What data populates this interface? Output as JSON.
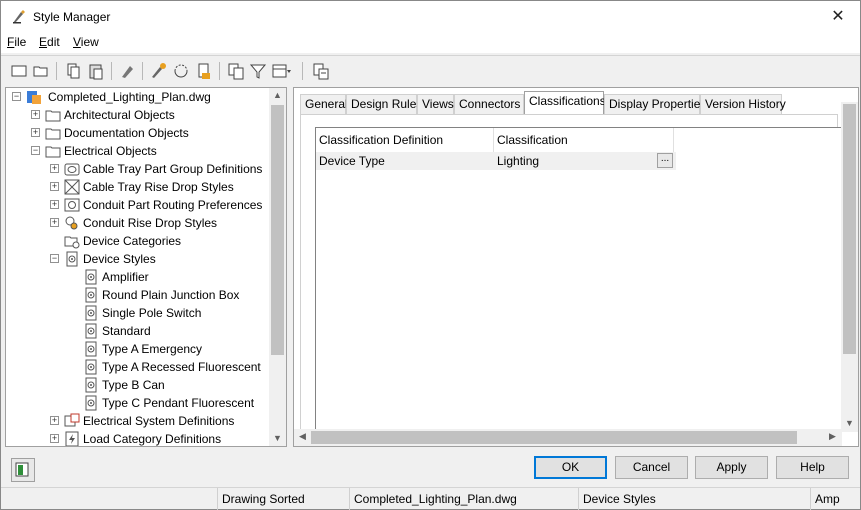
{
  "window": {
    "title": "Style Manager",
    "close_glyph": "✕"
  },
  "menu": {
    "items": [
      {
        "mnemonic": "F",
        "rest": "ile"
      },
      {
        "mnemonic": "E",
        "rest": "dit"
      },
      {
        "mnemonic": "V",
        "rest": "iew"
      }
    ]
  },
  "toolbar": {
    "icons": [
      "new-icon",
      "open-icon",
      "copy-icon",
      "paste-icon",
      "purge-icon",
      "edit-style-icon",
      "synchronize-icon",
      "version-icon",
      "toggle-view-icon",
      "filter-icon",
      "view-options-icon",
      "inquiry-icon"
    ]
  },
  "tree": {
    "root": "Completed_Lighting_Plan.dwg",
    "items": [
      {
        "label": "Architectural Objects",
        "icon": "folder-icon",
        "expander": "+"
      },
      {
        "label": "Documentation Objects",
        "icon": "folder-icon",
        "expander": "+"
      },
      {
        "label": "Electrical Objects",
        "icon": "folder-icon",
        "expander": "−"
      },
      {
        "label": "Cable Tray Part Group Definitions",
        "icon": "cable-tray-group-icon",
        "expander": "+"
      },
      {
        "label": "Cable Tray Rise Drop Styles",
        "icon": "rise-drop-icon",
        "expander": "+"
      },
      {
        "label": "Conduit Part Routing Preferences",
        "icon": "routing-pref-icon",
        "expander": "+"
      },
      {
        "label": "Conduit Rise Drop Styles",
        "icon": "conduit-rise-icon",
        "expander": "+"
      },
      {
        "label": "Device Categories",
        "icon": "device-category-icon",
        "expander": ""
      },
      {
        "label": "Device Styles",
        "icon": "device-style-icon",
        "expander": "−"
      },
      {
        "label": "Amplifier",
        "icon": "device-style-icon",
        "expander": ""
      },
      {
        "label": "Round Plain Junction Box",
        "icon": "device-style-icon",
        "expander": ""
      },
      {
        "label": "Single Pole Switch",
        "icon": "device-style-icon",
        "expander": ""
      },
      {
        "label": "Standard",
        "icon": "device-style-icon",
        "expander": ""
      },
      {
        "label": "Type A Emergency",
        "icon": "device-style-icon",
        "expander": ""
      },
      {
        "label": "Type A Recessed Fluorescent",
        "icon": "device-style-icon",
        "expander": ""
      },
      {
        "label": "Type B Can",
        "icon": "device-style-icon",
        "expander": ""
      },
      {
        "label": "Type C Pendant Fluorescent",
        "icon": "device-style-icon",
        "expander": ""
      },
      {
        "label": "Electrical System Definitions",
        "icon": "system-definition-icon",
        "expander": "+"
      },
      {
        "label": "Load Category Definitions",
        "icon": "load-category-icon",
        "expander": "+"
      }
    ]
  },
  "tabs": [
    "General",
    "Design Rules",
    "Views",
    "Connectors",
    "Classifications",
    "Display Properties",
    "Version History"
  ],
  "active_tab": "Classifications",
  "classifications": {
    "headers": [
      "Classification Definition",
      "Classification"
    ],
    "rows": [
      {
        "definition": "Device Type",
        "classification": "Lighting",
        "button": "..."
      }
    ]
  },
  "buttons": {
    "ok": "OK",
    "cancel": "Cancel",
    "apply": "Apply",
    "help": "Help"
  },
  "status": {
    "sort": "Drawing Sorted",
    "file": "Completed_Lighting_Plan.dwg",
    "category": "Device Styles",
    "item": "Amp"
  },
  "colors": {
    "accent": "#0078d7",
    "selected_bg": "#f0f0f0"
  }
}
